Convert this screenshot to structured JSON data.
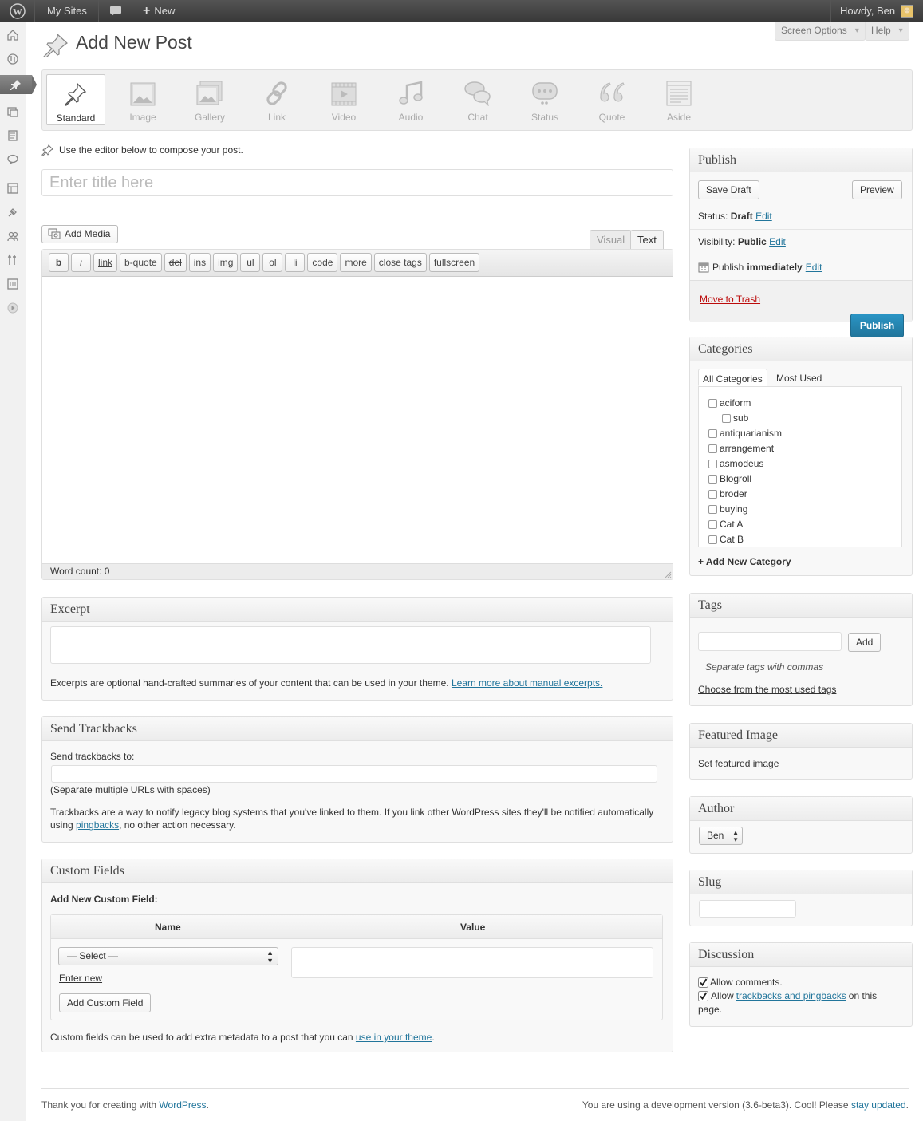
{
  "admin_bar": {
    "my_sites": "My Sites",
    "new": "New",
    "howdy": "Howdy, Ben"
  },
  "screen_meta": {
    "screen_options": "Screen Options",
    "help": "Help"
  },
  "page": {
    "title": "Add New Post",
    "format_description": "Use the editor below to compose your post.",
    "title_placeholder": "Enter title here"
  },
  "post_formats": [
    {
      "label": "Standard",
      "icon": "pushpin-icon"
    },
    {
      "label": "Image",
      "icon": "image-icon"
    },
    {
      "label": "Gallery",
      "icon": "gallery-icon"
    },
    {
      "label": "Link",
      "icon": "link-icon"
    },
    {
      "label": "Video",
      "icon": "video-icon"
    },
    {
      "label": "Audio",
      "icon": "audio-icon"
    },
    {
      "label": "Chat",
      "icon": "chat-icon"
    },
    {
      "label": "Status",
      "icon": "status-icon"
    },
    {
      "label": "Quote",
      "icon": "quote-icon"
    },
    {
      "label": "Aside",
      "icon": "aside-icon"
    }
  ],
  "editor": {
    "add_media": "Add Media",
    "tab_visual": "Visual",
    "tab_text": "Text",
    "quicktags": [
      "b",
      "i",
      "link",
      "b-quote",
      "del",
      "ins",
      "img",
      "ul",
      "ol",
      "li",
      "code",
      "more",
      "close tags",
      "fullscreen"
    ],
    "word_count": "Word count: 0"
  },
  "excerpt": {
    "title": "Excerpt",
    "help": "Excerpts are optional hand-crafted summaries of your content that can be used in your theme.",
    "link": "Learn more about manual excerpts."
  },
  "trackbacks": {
    "title": "Send Trackbacks",
    "label": "Send trackbacks to:",
    "hint": "(Separate multiple URLs with spaces)",
    "desc_line1": "Trackbacks are a way to notify legacy blog systems that you've linked to them. If you link other WordPress sites they'll be notified automatically",
    "desc_using": "using",
    "desc_link": "pingbacks",
    "desc_end": ", no other action necessary."
  },
  "custom_fields": {
    "title": "Custom Fields",
    "add_new": "Add New Custom Field:",
    "col_name": "Name",
    "col_value": "Value",
    "select": "— Select —",
    "enter_new": "Enter new",
    "add_button": "Add Custom Field",
    "help": "Custom fields can be used to add extra metadata to a post that you can",
    "help_link": "use in your theme",
    "help_end": "."
  },
  "publish": {
    "title": "Publish",
    "save_draft": "Save Draft",
    "preview": "Preview",
    "status_label": "Status:",
    "status_value": "Draft",
    "visibility_label": "Visibility:",
    "visibility_value": "Public",
    "publish_label": "Publish",
    "publish_value": "immediately",
    "edit": "Edit",
    "move_to_trash": "Move to Trash",
    "publish_button": "Publish"
  },
  "categories": {
    "title": "Categories",
    "tab_all": "All Categories",
    "tab_most_used": "Most Used",
    "items": [
      {
        "label": "aciform",
        "child": false
      },
      {
        "label": "sub",
        "child": true
      },
      {
        "label": "antiquarianism",
        "child": false
      },
      {
        "label": "arrangement",
        "child": false
      },
      {
        "label": "asmodeus",
        "child": false
      },
      {
        "label": "Blogroll",
        "child": false
      },
      {
        "label": "broder",
        "child": false
      },
      {
        "label": "buying",
        "child": false
      },
      {
        "label": "Cat A",
        "child": false
      },
      {
        "label": "Cat B",
        "child": false
      }
    ],
    "add_new": "+ Add New Category"
  },
  "tags": {
    "title": "Tags",
    "add": "Add",
    "hint": "Separate tags with commas",
    "choose": "Choose from the most used tags"
  },
  "featured_image": {
    "title": "Featured Image",
    "link": "Set featured image"
  },
  "author": {
    "title": "Author",
    "value": "Ben"
  },
  "slug": {
    "title": "Slug"
  },
  "discussion": {
    "title": "Discussion",
    "allow_comments": "Allow comments.",
    "allow": "Allow",
    "trackbacks_link": "trackbacks and pingbacks",
    "on_this": "on this",
    "page": "page."
  },
  "footer": {
    "thanks": "Thank you for creating with",
    "wordpress": "WordPress",
    "thanks_end": ".",
    "version": "You are using a development version (3.6-beta3). Cool! Please",
    "stay_updated": "stay updated",
    "version_end": "."
  },
  "colors": {
    "link": "#21759b",
    "publish_button": "#2a95c5",
    "trash": "#bc0b0b",
    "admin_bar": "#464646"
  }
}
